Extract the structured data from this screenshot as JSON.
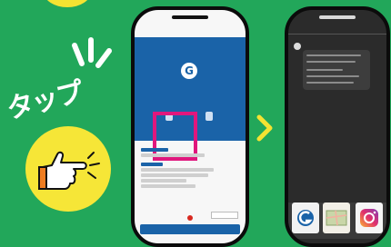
{
  "caption": {
    "tap_label": "タップ"
  },
  "left_phone": {
    "status_bar": "",
    "header": "",
    "profile_name": "",
    "buttons": [
      {
        "label": ""
      },
      {
        "label": ""
      }
    ],
    "bottom_button_label": ""
  },
  "right_phone": {
    "header": "",
    "sender": "",
    "message": ""
  },
  "icons": {
    "tap_hand": "pointing-hand-icon",
    "arrow": "chevron-right-icon",
    "logo": "brand-logo-icon",
    "instagram": "instagram-icon"
  },
  "colors": {
    "background": "#22a75a",
    "accent_yellow": "#f4e332",
    "highlight": "#e0177d",
    "brand_blue": "#1a63a8"
  }
}
